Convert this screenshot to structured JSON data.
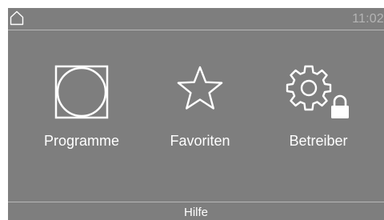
{
  "status_bar": {
    "home_icon": "home-icon",
    "time": "11:02"
  },
  "tiles": [
    {
      "label": "Programme",
      "icon": "programme-icon"
    },
    {
      "label": "Favoriten",
      "icon": "star-icon"
    },
    {
      "label": "Betreiber",
      "icon": "gear-lock-icon"
    }
  ],
  "help_bar": {
    "label": "Hilfe"
  },
  "colors": {
    "background": "#7e7e7e",
    "foreground": "#ffffff",
    "muted": "#b4b4b4"
  }
}
